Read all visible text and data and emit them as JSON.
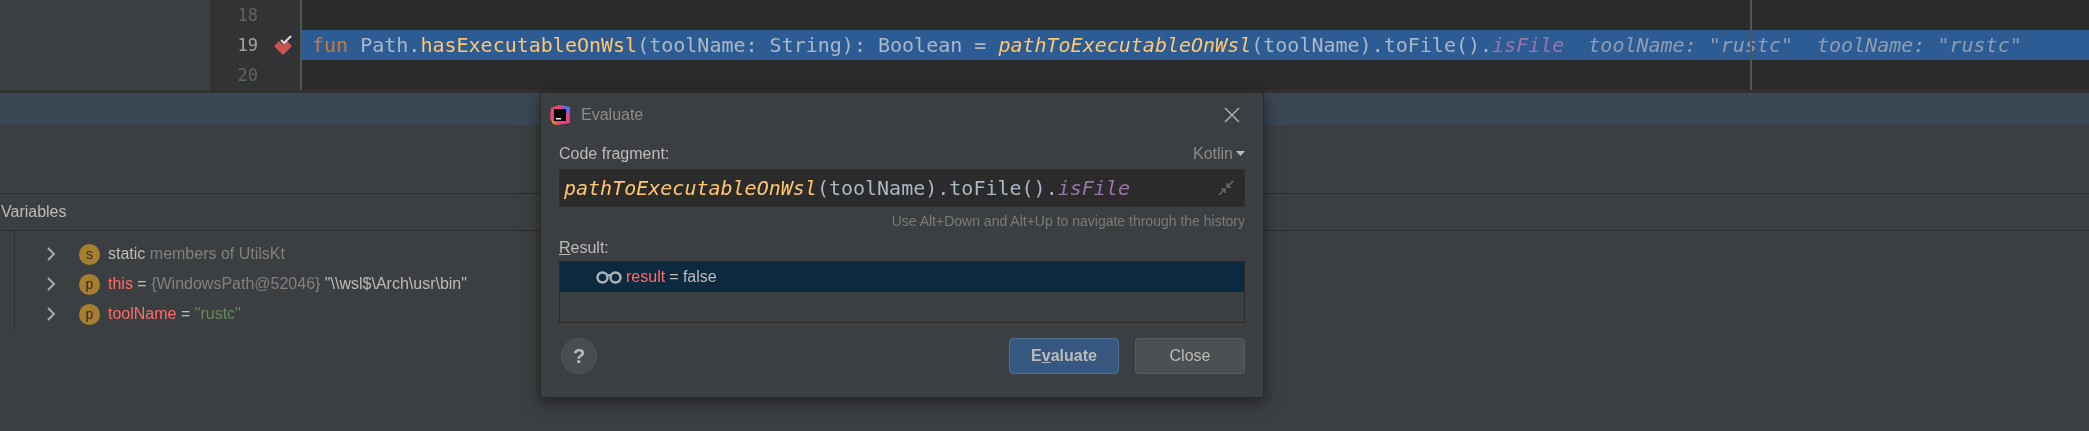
{
  "editor": {
    "lines": [
      {
        "number": "18",
        "breakpoint": false,
        "selected": false
      },
      {
        "number": "19",
        "breakpoint": true,
        "selected": true,
        "tokens": [
          {
            "kind": "keyword",
            "text": "fun "
          },
          {
            "kind": "plain",
            "text": "Path."
          },
          {
            "kind": "function",
            "text": "hasExecutableOnWsl"
          },
          {
            "kind": "plain",
            "text": "(toolName: String): Boolean = "
          },
          {
            "kind": "call",
            "text": "pathToExecutableOnWsl"
          },
          {
            "kind": "plain",
            "text": "(toolName).toFile()."
          },
          {
            "kind": "property",
            "text": "isFile"
          },
          {
            "kind": "hint",
            "text": "toolName: \"rustc\""
          },
          {
            "kind": "hint",
            "text": "toolName: \"rustc\""
          }
        ]
      },
      {
        "number": "20",
        "breakpoint": false,
        "selected": false
      }
    ]
  },
  "variables": {
    "title": "Variables",
    "items": [
      {
        "badge": "s",
        "name": "static",
        "kind": "static",
        "type": "members of UtilsKt"
      },
      {
        "badge": "p",
        "name": "this",
        "kind": "param",
        "sep": "=",
        "type": "{WindowsPath@52046}",
        "value": "\"\\\\wsl$\\Arch\\usr\\bin\""
      },
      {
        "badge": "p",
        "name": "toolName",
        "kind": "param",
        "sep": "=",
        "value": "\"rustc\""
      }
    ]
  },
  "dialog": {
    "title": "Evaluate",
    "fragment_label": "Code fragment:",
    "language": "Kotlin",
    "fragment": [
      {
        "kind": "call",
        "text": "pathToExecutableOnWsl"
      },
      {
        "kind": "plain",
        "text": "(toolName).toFile()."
      },
      {
        "kind": "property",
        "text": "isFile"
      }
    ],
    "hint": "Use Alt+Down and Alt+Up to navigate through the history",
    "result_label": [
      {
        "text": "R",
        "underline": true
      },
      {
        "text": "esult:",
        "underline": false
      }
    ],
    "result": {
      "name": "result",
      "sep": "=",
      "value": "false",
      "selected": true
    },
    "help": "?",
    "buttons": [
      {
        "parts": [
          {
            "text": "E",
            "underline": false
          },
          {
            "text": "v",
            "underline": true
          },
          {
            "text": "aluate",
            "underline": false
          }
        ],
        "default": true
      },
      {
        "parts": [
          {
            "text": "Close",
            "underline": false
          }
        ],
        "default": false
      }
    ]
  }
}
